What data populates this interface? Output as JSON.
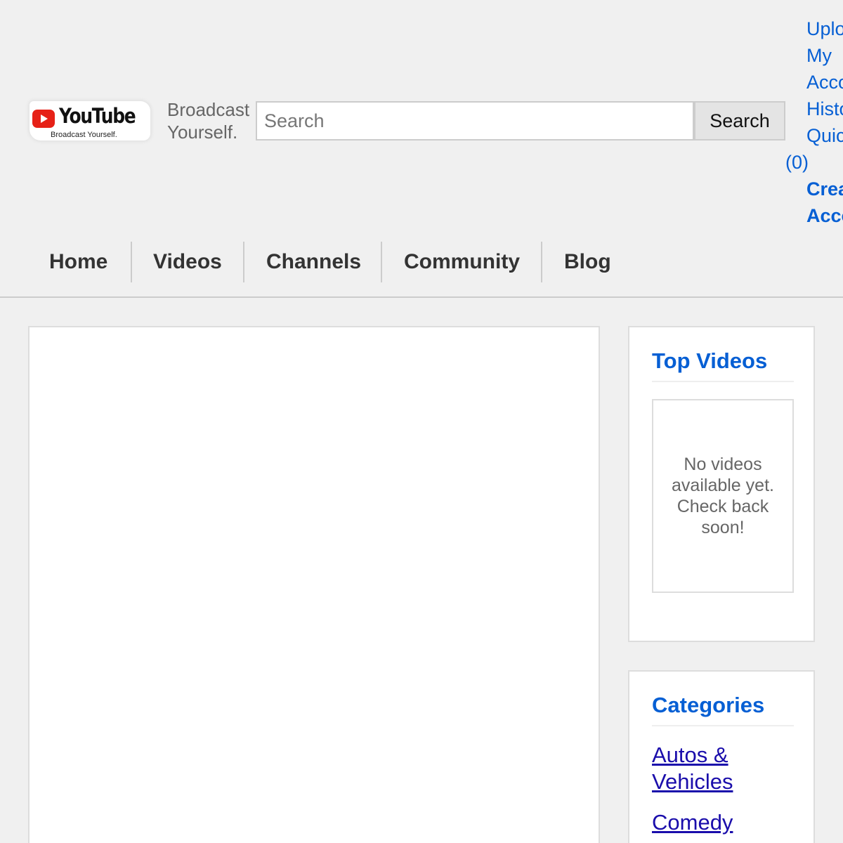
{
  "logo": {
    "wordmark": "YouTube",
    "tagline_small": "Broadcast Yourself."
  },
  "header": {
    "tagline_line1": "Broadcast",
    "tagline_line2": "Yourself.",
    "search": {
      "placeholder": "Search",
      "button_label": "Search"
    },
    "user_links": {
      "upload": "Upload",
      "my_account": "My Account",
      "history": "History",
      "quicklist": "QuickList",
      "quicklist_count": "(0)",
      "create_account": "Create Account"
    }
  },
  "nav": {
    "tabs": [
      {
        "label": "Home"
      },
      {
        "label": "Videos"
      },
      {
        "label": "Channels"
      },
      {
        "label": "Community"
      },
      {
        "label": "Blog"
      }
    ]
  },
  "sidebar": {
    "top_videos": {
      "heading": "Top Videos",
      "empty_message": "No videos available yet. Check back soon!"
    },
    "categories": {
      "heading": "Categories",
      "items": [
        {
          "label": "Autos & Vehicles"
        },
        {
          "label": "Comedy"
        }
      ]
    }
  },
  "colors": {
    "page_background": "#f0f0f0",
    "link_blue": "#065fd4",
    "category_link": "#1a0dab",
    "brand_red": "#e62117"
  }
}
